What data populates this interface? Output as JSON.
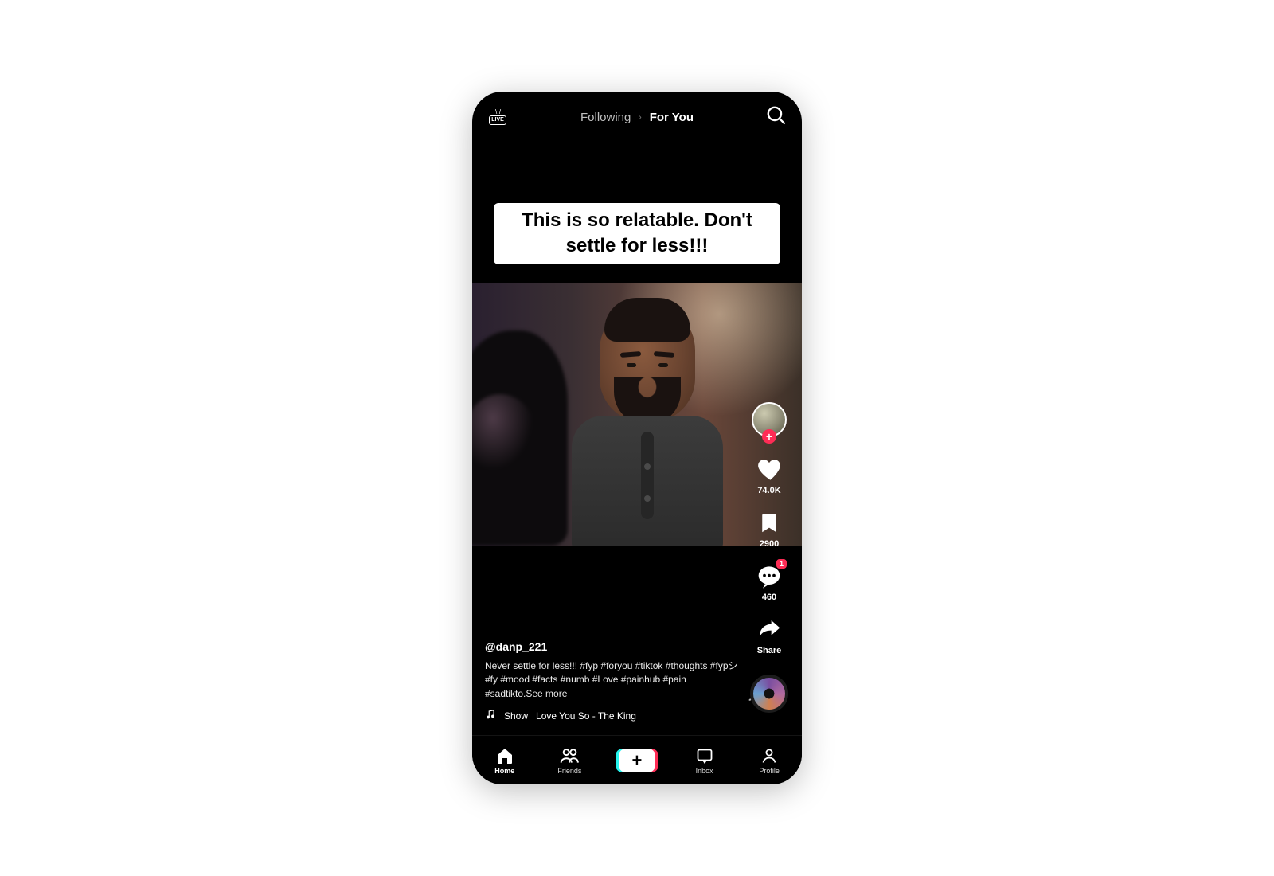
{
  "topbar": {
    "live_label": "LIVE",
    "tab_following": "Following",
    "tab_for_you": "For You"
  },
  "overlay_text": "This is so relatable. Don't settle for less!!!",
  "rail": {
    "like_count": "74.0K",
    "bookmark_count": "2900",
    "comment_count": "460",
    "comment_badge": "1",
    "share_label": "Share"
  },
  "meta": {
    "username": "@danp_221",
    "caption_prefix": "Never settle for less!!! ",
    "hashtags": "#fyp #foryou #tiktok #thoughts #fypシ #fy #mood #facts #numb #Love #painhub #pain #sadtikto",
    "see_more": "See more",
    "sound_prefix": "Show",
    "sound_title": "Love You So - The King"
  },
  "nav": {
    "home": "Home",
    "friends": "Friends",
    "inbox": "Inbox",
    "profile": "Profile"
  }
}
